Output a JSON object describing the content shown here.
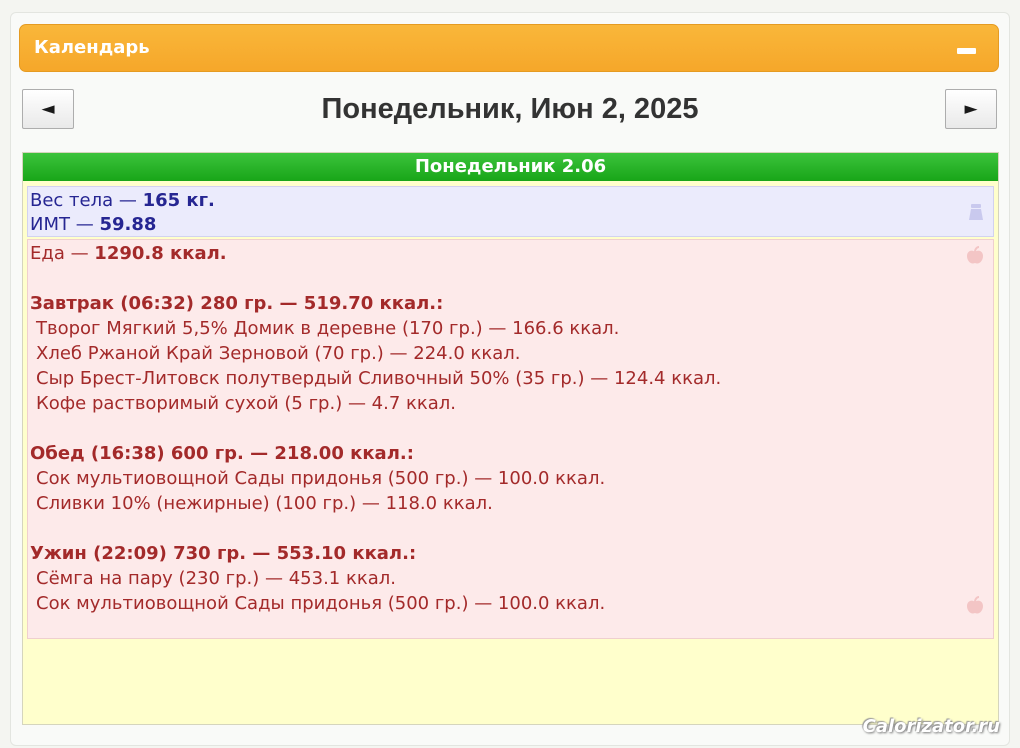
{
  "calendar": {
    "title": "Календарь",
    "prev_label": "◄",
    "next_label": "►",
    "date_title": "Понедельник, Июн 2, 2025"
  },
  "day": {
    "header": "Понедельник 2.06",
    "weight": {
      "label": "Вес тела — ",
      "value": "165 кг."
    },
    "bmi": {
      "label": "ИМТ — ",
      "value": "59.88"
    },
    "food_total": {
      "label": "Еда — ",
      "value": "1290.8 ккал."
    },
    "meals": [
      {
        "title": "Завтрак (06:32) 280 гр. — 519.70 ккал.:",
        "items": [
          "Творог Мягкий 5,5% Домик в деревне (170 гр.) — 166.6 ккал.",
          "Хлеб Ржаной Край Зерновой (70 гр.) — 224.0 ккал.",
          "Сыр Брест-Литовск полутвердый Сливочный 50% (35 гр.) — 124.4 ккал.",
          "Кофе растворимый сухой (5 гр.) — 4.7 ккал."
        ]
      },
      {
        "title": "Обед (16:38) 600 гр. — 218.00 ккал.:",
        "items": [
          "Сок мультиовощной Сады придонья (500 гр.) — 100.0 ккал.",
          "Сливки 10% (нежирные) (100 гр.) — 118.0 ккал."
        ]
      },
      {
        "title": "Ужин (22:09) 730 гр. — 553.10 ккал.:",
        "items": [
          "Сёмга на пару (230 гр.) — 453.1 ккал.",
          "Сок мультиовощной Сады придонья (500 гр.) — 100.0 ккал."
        ]
      }
    ]
  },
  "icons": {
    "collapse": "minus-icon",
    "weight": "scale-icon",
    "food": "apple-icon"
  },
  "colors": {
    "calendar_header": "#f7ab2f",
    "day_header": "#22aa22",
    "weight_text": "#262692",
    "food_text": "#a32a2a",
    "panel_bg": "#ffffcc"
  },
  "watermark": "Calorizator.ru"
}
